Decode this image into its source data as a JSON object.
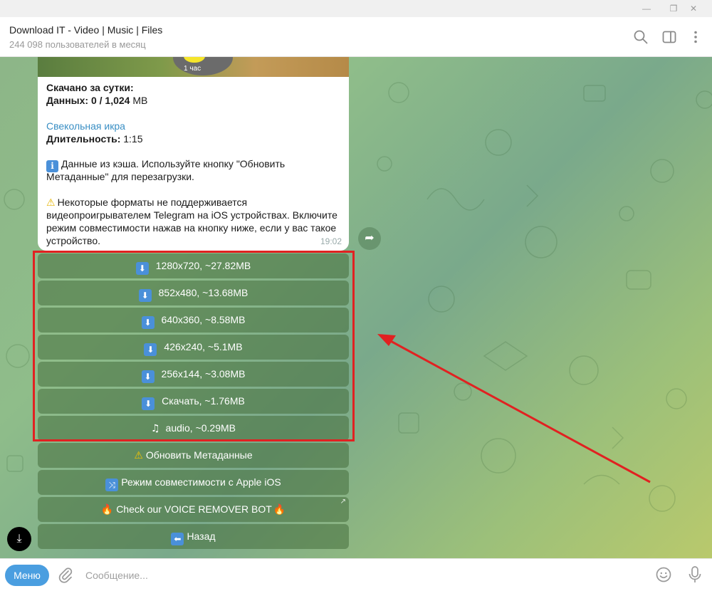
{
  "window": {
    "minimize": "—",
    "restore": "❐",
    "close": "✕"
  },
  "header": {
    "title": "Download IT - Video | Music | Files",
    "subtitle": "244 098 пользователей в месяц"
  },
  "message": {
    "media_badge": "1 час",
    "downloaded_title": "Скачано за сутки:",
    "data_label": "Данных:",
    "data_value": "0 / 1,024",
    "data_unit": "MB",
    "track_link": "Свекольная икра",
    "duration_label": "Длительность:",
    "duration_value": "1:15",
    "info_line1": "Данные из кэша. Используйте кнопку \"Обновить",
    "info_line2": "Метаданные\" для перезагрузки.",
    "warn_line1": "Некоторые форматы не поддерживается",
    "warn_line2": "видеопроигрывателем Telegram на iOS устройствах. Включите",
    "warn_line3": "режим совместимости нажав на кнопку ниже, если у вас такое",
    "warn_line4": "устройство.",
    "time": "19:02"
  },
  "keyboard": {
    "buttons": [
      {
        "label": "1280x720, ~27.82MB"
      },
      {
        "label": "852x480, ~13.68MB"
      },
      {
        "label": "640x360, ~8.58MB"
      },
      {
        "label": "426x240, ~5.1MB"
      },
      {
        "label": "256x144, ~3.08MB"
      },
      {
        "label": "Скачать, ~1.76MB"
      },
      {
        "label": "audio, ~0.29MB"
      },
      {
        "label": "Обновить Метаданные"
      },
      {
        "label": "Режим совместимости с Apple iOS"
      },
      {
        "label": "Check our VOICE REMOVER BOT"
      },
      {
        "label": "Назад"
      }
    ]
  },
  "input": {
    "menu_label": "Меню",
    "placeholder": "Сообщение..."
  },
  "colors": {
    "highlight": "#e12121",
    "accent": "#4a9ee0",
    "link": "#3a8fc4"
  }
}
